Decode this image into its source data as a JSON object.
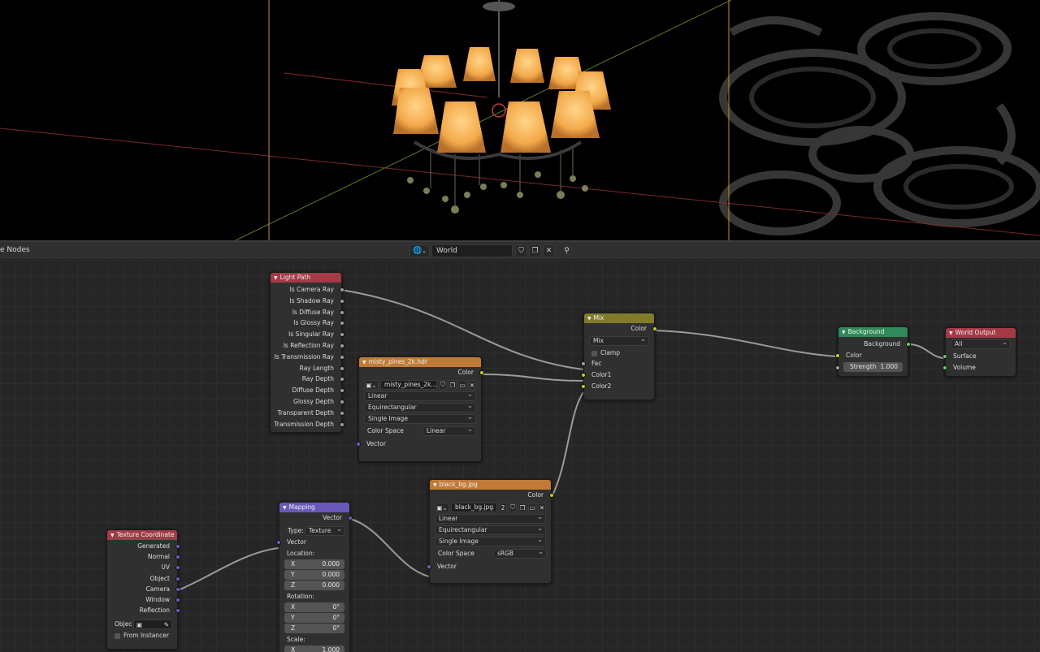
{
  "header": {
    "editor_title": "e Nodes",
    "world_name": "World",
    "icons": [
      "world-icon",
      "shield-icon",
      "duplicate-icon",
      "close-icon",
      "pin-icon"
    ]
  },
  "colors": {
    "header_input": "#a33a46",
    "header_texture": "#c27a37",
    "header_shader": "#2e8a58",
    "header_converter": "#807c2a",
    "header_vector": "#6a58b8",
    "header_output": "#a33a46"
  },
  "nodes": {
    "light_path": {
      "title": "Light Path",
      "outputs": [
        "Is Camera Ray",
        "Is Shadow Ray",
        "Is Diffuse Ray",
        "Is Glossy Ray",
        "Is Singular Ray",
        "Is Reflection Ray",
        "Is Transmission Ray",
        "Ray Length",
        "Ray Depth",
        "Diffuse Depth",
        "Glossy Depth",
        "Transparent Depth",
        "Transmission Depth"
      ]
    },
    "env_tex": {
      "title": "misty_pines_2k.hdr",
      "output": "Color",
      "image_name": "misty_pines_2k...",
      "interpolation": "Linear",
      "projection": "Equirectangular",
      "source": "Single Image",
      "color_space_label": "Color Space",
      "color_space": "Linear",
      "input": "Vector"
    },
    "black_bg": {
      "title": "black_bg.jpg",
      "output": "Color",
      "image_name": "black_bg.jpg",
      "users": "2",
      "interpolation": "Linear",
      "projection": "Equirectangular",
      "source": "Single Image",
      "color_space_label": "Color Space",
      "color_space": "sRGB",
      "input": "Vector"
    },
    "mix": {
      "title": "Mix",
      "output": "Color",
      "blend": "Mix",
      "clamp": "Clamp",
      "inputs": [
        "Fac",
        "Color1",
        "Color2"
      ]
    },
    "background": {
      "title": "Background",
      "output": "Background",
      "input_color": "Color",
      "strength_label": "Strength",
      "strength": "1.000"
    },
    "world_output": {
      "title": "World Output",
      "target": "All",
      "inputs": [
        "Surface",
        "Volume"
      ]
    },
    "tex_coord": {
      "title": "Texture Coordinate",
      "outputs": [
        "Generated",
        "Normal",
        "UV",
        "Object",
        "Camera",
        "Window",
        "Reflection"
      ],
      "object_label": "Objec",
      "from_instancer": "From Instancer"
    },
    "mapping": {
      "title": "Mapping",
      "output": "Vector",
      "type_label": "Type:",
      "type": "Texture",
      "input_vector": "Vector",
      "location_label": "Location:",
      "location": [
        {
          "axis": "X",
          "value": "0.000"
        },
        {
          "axis": "Y",
          "value": "0.000"
        },
        {
          "axis": "Z",
          "value": "0.000"
        }
      ],
      "rotation_label": "Rotation:",
      "rotation": [
        {
          "axis": "X",
          "value": "0°"
        },
        {
          "axis": "Y",
          "value": "0°"
        },
        {
          "axis": "Z",
          "value": "0°"
        }
      ],
      "scale_label": "Scale:",
      "scale": [
        {
          "axis": "X",
          "value": "1.000"
        }
      ]
    }
  }
}
